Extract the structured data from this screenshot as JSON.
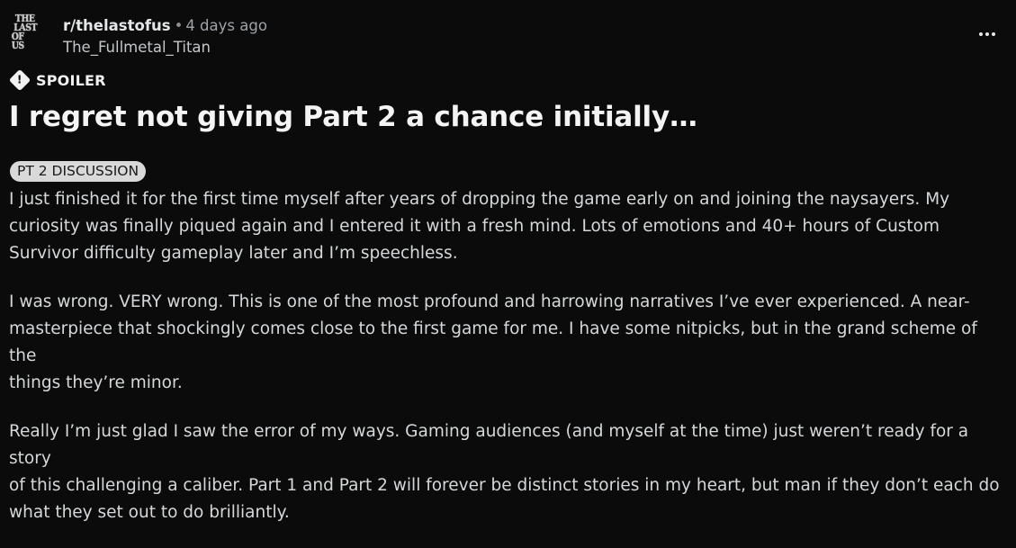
{
  "post": {
    "subreddit": "r/thelastofus",
    "separator": "•",
    "time_ago": "4 days ago",
    "username": "The_Fullmetal_Titan",
    "avatar_text": [
      "THE",
      "LAST",
      "OF US"
    ],
    "spoiler_label": "SPOILER",
    "title": "I regret not giving Part 2 a chance initially…",
    "flair": "PT 2 DISCUSSION",
    "paragraphs": [
      "I just finished it for the first time myself after years of dropping the game early on and joining the naysayers. My\ncuriosity was finally piqued again and I entered it with a fresh mind. Lots of emotions and 40+ hours of Custom\nSurvivor difficulty gameplay later and I’m speechless.",
      "I was wrong. VERY wrong. This is one of the most profound and harrowing narratives I’ve ever experienced. A near-\nmasterpiece that shockingly comes close to the first game for me. I have some nitpicks, but in the grand scheme of the\nthings they’re minor.",
      "Really I’m just glad I saw the error of my ways. Gaming audiences (and myself at the time) just weren’t ready for a story\nof this challenging a caliber. Part 1 and Part 2 will forever be distinct stories in my heart, but man if they don’t each do\nwhat they set out to do brilliantly."
    ]
  },
  "icons": {
    "more": "more-options-icon",
    "spoiler": "spoiler-warning-icon"
  },
  "colors": {
    "background": "#0b0b0b",
    "text": "#d7dadc",
    "flair_bg": "#d9d9d9"
  }
}
